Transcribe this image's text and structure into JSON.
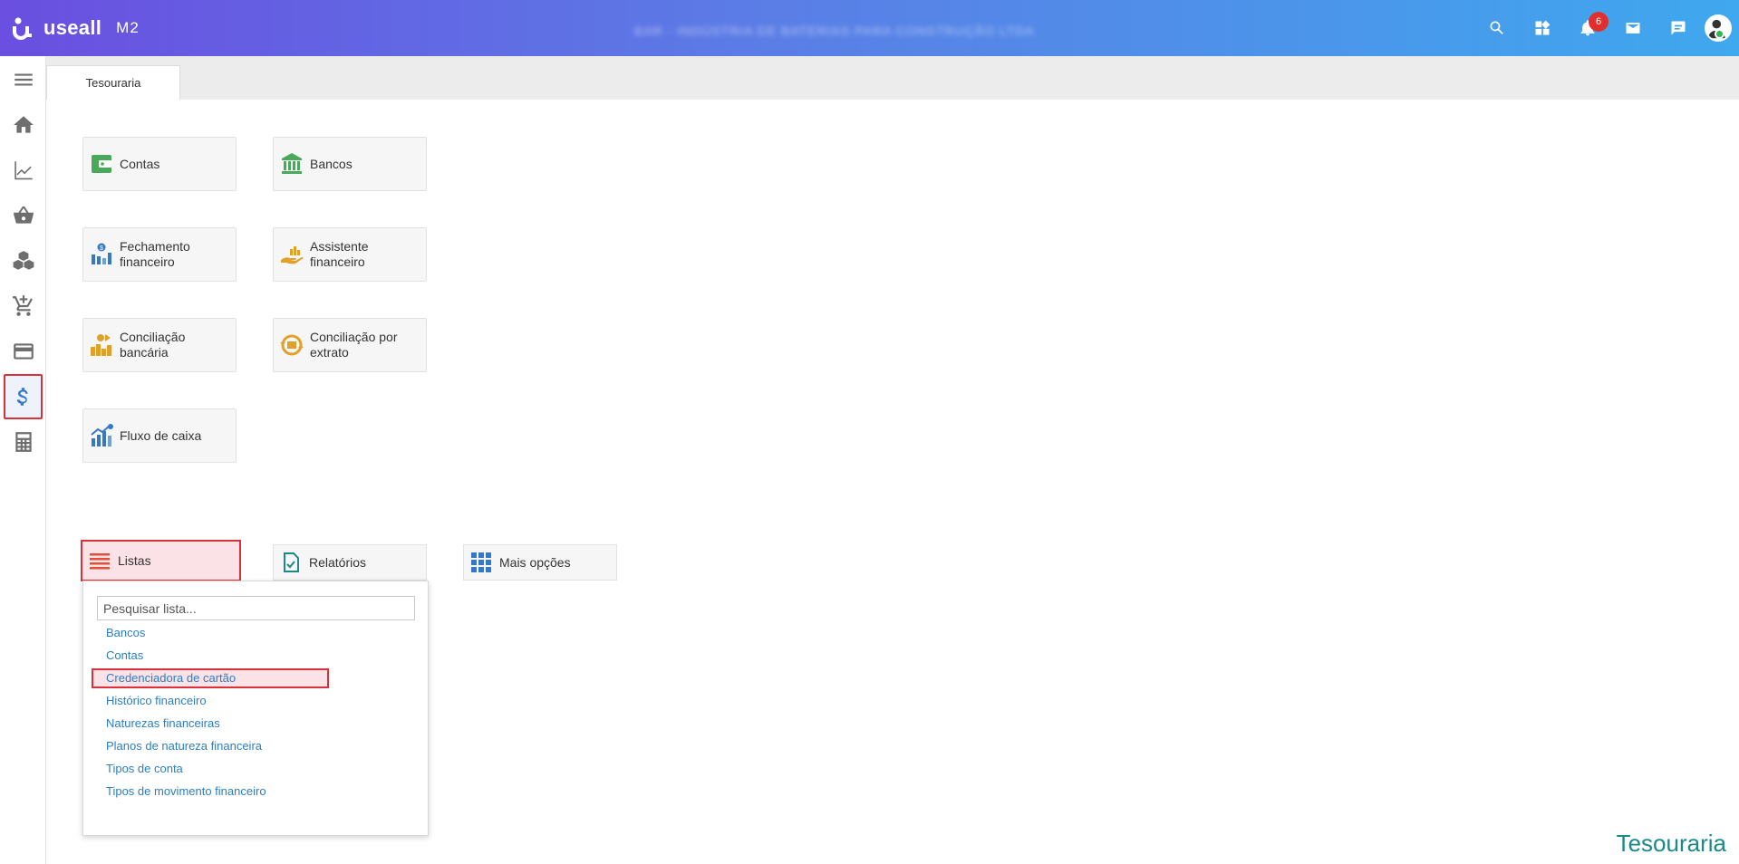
{
  "header": {
    "logo_text": "useall",
    "logo_suffix": "M2",
    "company_name": "BAR - INDÚSTRIA DE BATERIAS PARA CONSTRUÇÃO LTDA",
    "notification_count": "6",
    "icons": [
      "search-icon",
      "widgets-icon",
      "bell-icon",
      "mail-icon",
      "chat-icon",
      "avatar"
    ]
  },
  "sidebar": {
    "items": [
      "menu-icon",
      "home-icon",
      "chart-icon",
      "basket-icon",
      "boxes-icon",
      "cart-add-icon",
      "card-icon",
      "dollar-icon",
      "calculator-icon"
    ],
    "active": "dollar-icon"
  },
  "tabs": [
    {
      "label": "Tesouraria"
    }
  ],
  "tiles": [
    {
      "label": "Contas"
    },
    {
      "label": "Bancos"
    },
    {
      "label": "Fechamento financeiro"
    },
    {
      "label": "Assistente financeiro"
    },
    {
      "label": "Conciliação bancária"
    },
    {
      "label": "Conciliação por extrato"
    },
    {
      "label": "Fluxo de caixa"
    }
  ],
  "buttons": [
    {
      "label": "Listas"
    },
    {
      "label": "Relatórios"
    },
    {
      "label": "Mais opções"
    }
  ],
  "dropdown": {
    "placeholder": "Pesquisar lista...",
    "items": [
      "Bancos",
      "Contas",
      "Credenciadora de cartão",
      "Histórico financeiro",
      "Naturezas financeiras",
      "Planos de natureza financeira",
      "Tipos de conta",
      "Tipos de movimento financeiro"
    ],
    "highlighted": "Credenciadora de cartão"
  },
  "footer": {
    "module_title": "Tesouraria"
  },
  "colors": {
    "accent": "#3578c6",
    "highlight_border": "#d9303a",
    "link": "#2a7fc4",
    "module_title": "#1b8a87"
  }
}
